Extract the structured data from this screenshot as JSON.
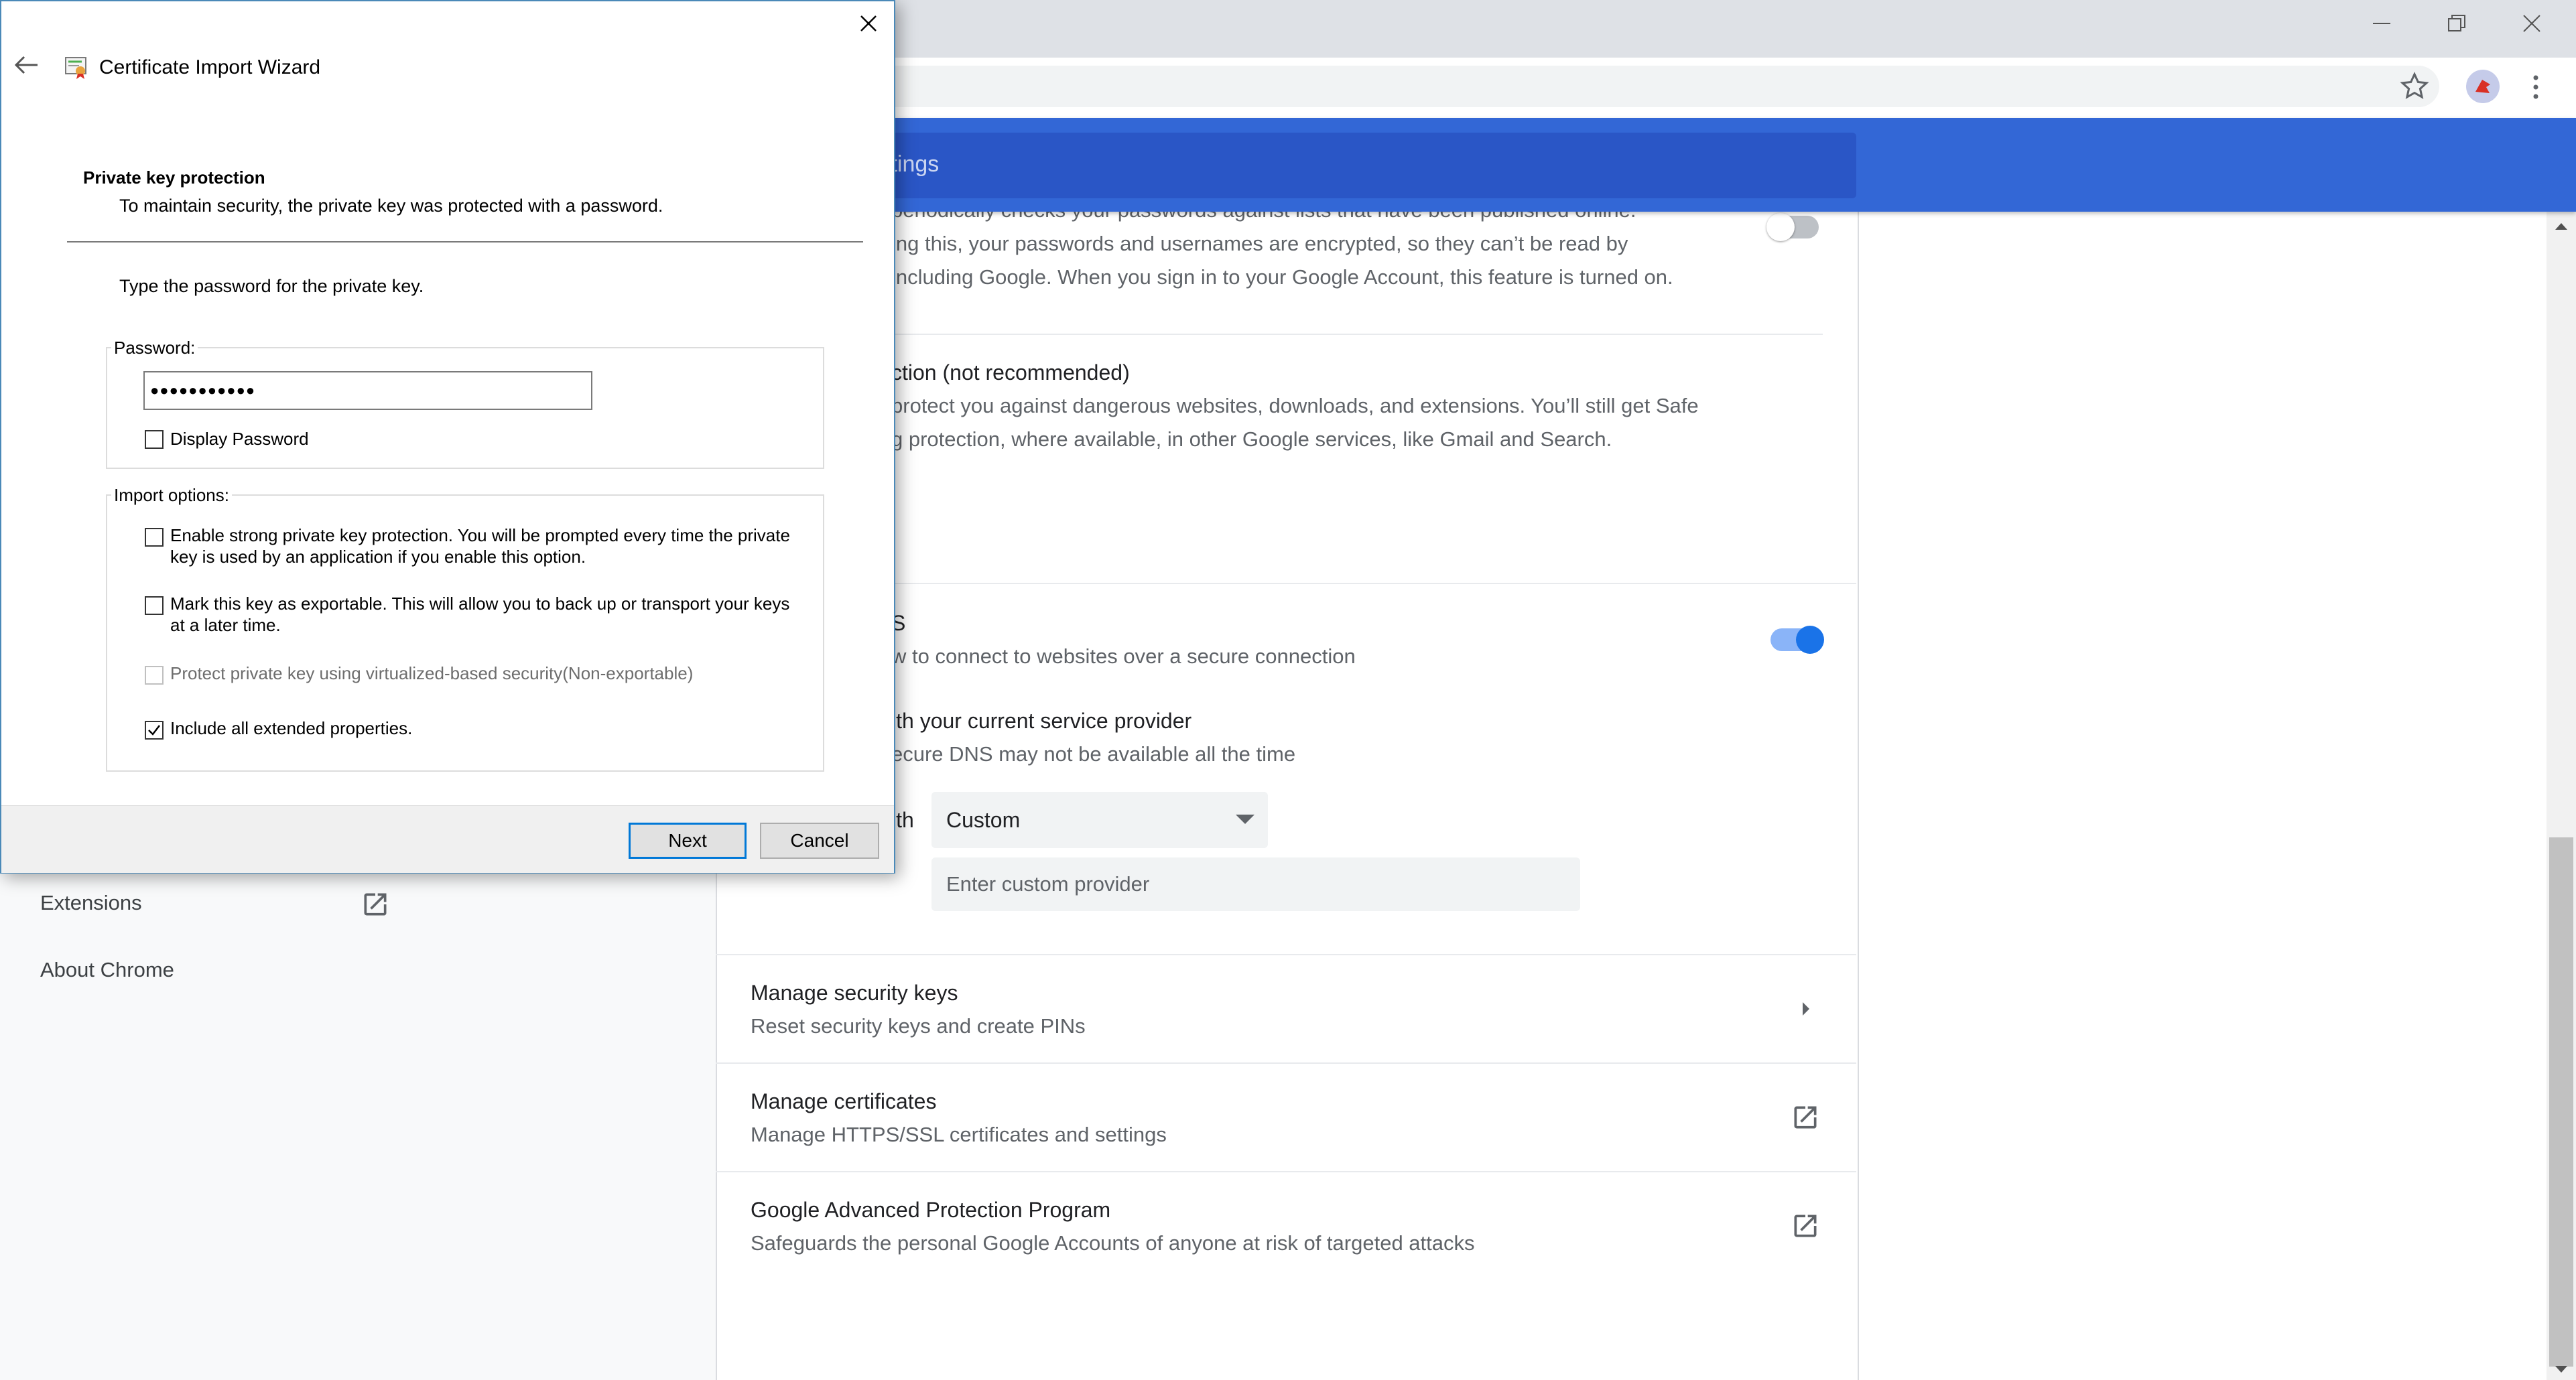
{
  "dialog": {
    "title": "Certificate Import Wizard",
    "section_title": "Private key protection",
    "section_subtitle": "To maintain security, the private key was protected with a password.",
    "instruction": "Type the password for the private key.",
    "password_label": "Password:",
    "password_value": "●●●●●●●●●●●",
    "display_password_label": "Display Password",
    "import_options_label": "Import options:",
    "options": [
      {
        "line1": "Enable strong private key protection. You will be prompted every time the private",
        "line2": "key is used by an application if you enable this option.",
        "checked": false
      },
      {
        "line1": "Mark this key as exportable. This will allow you to back up or transport your keys",
        "line2": "at a later time.",
        "checked": false
      },
      {
        "line1": "Protect private key using virtualized-based security(Non-exportable)",
        "checked": false,
        "disabled": true
      },
      {
        "line1": "Include all extended properties.",
        "checked": true
      }
    ],
    "next_label": "Next",
    "cancel_label": "Cancel"
  },
  "browser": {
    "search_placeholder_fragment": "ttings",
    "sidebar": {
      "extensions_label": "Extensions",
      "about_label": "About Chrome"
    },
    "content": {
      "password_check_lines": [
        "periodically checks your passwords against lists that have been published online.",
        "ing this, your passwords and usernames are encrypted, so they can’t be read by",
        "including Google. When you sign in to your Google Account, this feature is turned on."
      ],
      "no_protection_title": "ction (not recommended)",
      "no_protection_lines": [
        "protect you against dangerous websites, downloads, and extensions. You’ll still get Safe",
        "g protection, where available, in other Google services, like Gmail and Search."
      ],
      "secure_dns_title": "S",
      "secure_dns_desc": "w to connect to websites over a secure connection",
      "current_provider_title": "ith your current service provider",
      "current_provider_desc": "ecure DNS may not be available all the time",
      "with_label": "ith",
      "provider_select_value": "Custom",
      "custom_provider_placeholder": "Enter custom provider",
      "security_keys_title": "Manage security keys",
      "security_keys_desc": "Reset security keys and create PINs",
      "certificates_title": "Manage certificates",
      "certificates_desc": "Manage HTTPS/SSL certificates and settings",
      "advanced_protection_title": "Google Advanced Protection Program",
      "advanced_protection_desc": "Safeguards the personal Google Accounts of anyone at risk of targeted attacks"
    }
  },
  "colors": {
    "chrome_blue": "#3367d6",
    "toggle_on": "#1a73e8",
    "dialog_border": "#4a89b8",
    "default_button_border": "#0078d7"
  }
}
